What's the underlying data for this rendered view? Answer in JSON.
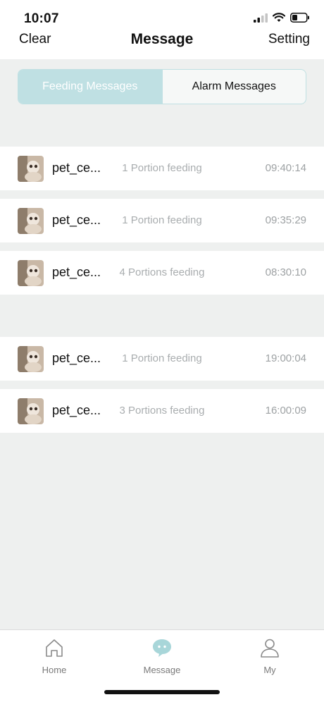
{
  "status": {
    "time": "10:07"
  },
  "header": {
    "left": "Clear",
    "title": "Message",
    "right": "Setting"
  },
  "segments": {
    "active": "Feeding Messages",
    "inactive": "Alarm Messages"
  },
  "groups": [
    {
      "rows": [
        {
          "name": "pet_ce...",
          "desc": "1 Portion feeding",
          "time": "09:40:14"
        },
        {
          "name": "pet_ce...",
          "desc": "1 Portion feeding",
          "time": "09:35:29"
        },
        {
          "name": "pet_ce...",
          "desc": "4 Portions feeding",
          "time": "08:30:10"
        }
      ]
    },
    {
      "rows": [
        {
          "name": "pet_ce...",
          "desc": "1 Portion feeding",
          "time": "19:00:04"
        },
        {
          "name": "pet_ce...",
          "desc": "3 Portions feeding",
          "time": "16:00:09"
        }
      ]
    }
  ],
  "tabs": [
    {
      "label": "Home",
      "icon": "home-icon"
    },
    {
      "label": "Message",
      "icon": "chat-bubble-icon"
    },
    {
      "label": "My",
      "icon": "person-icon"
    }
  ],
  "colors": {
    "accent": "#bfe0e3",
    "background": "#eef0ef"
  }
}
